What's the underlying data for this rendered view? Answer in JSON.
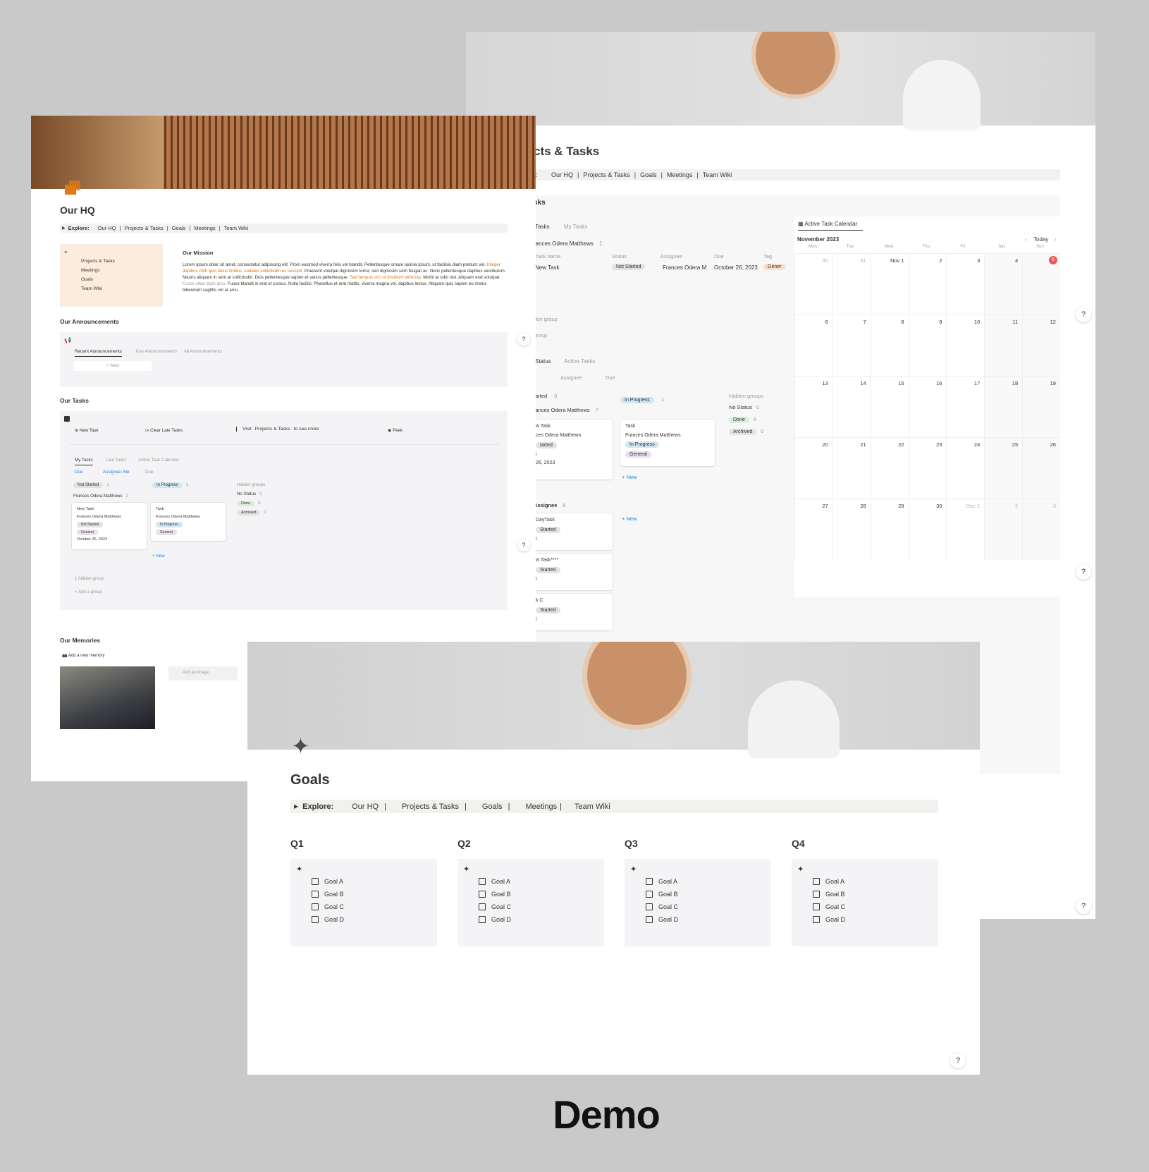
{
  "caption": "Demo",
  "colors": {
    "accent": "#e27a14",
    "background": "#c9c9c9",
    "today": "#eb5757"
  },
  "nav": {
    "explore": "Explore:",
    "items": [
      "Our HQ",
      "Projects & Tasks",
      "Goals",
      "Meetings",
      "Team Wiki"
    ],
    "sep": "|"
  },
  "hq": {
    "title": "Our HQ",
    "side_items": [
      "Projects & Tasks",
      "Meetings",
      "Goals",
      "Team Wiki"
    ],
    "mission_title": "Our Mission",
    "mission_text_1": "Lorem ipsum dolor sit amet, consectetur adipiscing elit. Proin euismod viverra felis vel blandit. Pellentesque ornare lacinia ipsum, ut facilisis diam pretium vel.",
    "mission_highlight_1": "Integer dapibus nibh quis lacus finibus, sodales sollicitudin ex suscipit.",
    "mission_text_2": "Praesent volutpat dignissim tortor, sed dignissim sem feugiat ac. Nunc pellentesque dapibus vestibulum. Mauris aliquam in sem at sollicitudin. Duis pellentesque sapien et varius pellentesque.",
    "mission_highlight_2": "Sed tempus orci ut tincidunt vehicula.",
    "mission_text_3": "Morbi at odio nisl. Aliquam erat volutpat.",
    "mission_muted": "Fusce vitae diam arcu.",
    "mission_text_4": "Fusce blandit in erat et cursus. Nulla facilisi. Phasellus et erat mattis, viverra magna vel, dapibus lectus. Aliquam quis sapien eu metus bibendum sagittis vel at arcu.",
    "announcements_title": "Our Announcements",
    "ann_tabs": [
      "Recent Announcements",
      "Key Announcements",
      "All Announcements"
    ],
    "ann_new": "+ New",
    "tasks_title": "Our Tasks",
    "btn_new_task": "New Task",
    "btn_clear": "Clear Late Tasks",
    "visit_pre": "Visit",
    "visit_link": "Projects & Tasks",
    "visit_post": "to see more",
    "btn_peek": "Peek",
    "task_tabs": [
      "My Tasks",
      "Late Tasks",
      "Active Task Calendar"
    ],
    "filters": [
      "Due",
      "Assignee: Me",
      "Due"
    ],
    "col_not_started": "Not Started",
    "col_not_started_count": "1",
    "col_in_progress": "In Progress",
    "col_in_progress_count": "1",
    "group_name": "Frances Odera Matthews",
    "group_count": "2",
    "hidden_groups": "Hidden groups",
    "hidden_list": [
      {
        "label": "No Status",
        "count": "0"
      },
      {
        "label": "Done",
        "count": "5"
      },
      {
        "label": "Archived",
        "count": "0"
      }
    ],
    "card1": {
      "title": "New Task",
      "assignee": "Frances Odera Matthews",
      "status": "Not Started",
      "tag": "General",
      "date": "October 26, 2023"
    },
    "card2": {
      "title": "Task",
      "assignee": "Frances Odera Matthews",
      "status": "In Progress",
      "tag": "General"
    },
    "new": "+ New",
    "hidden_group": "1 hidden group",
    "add_group": "+ Add a group",
    "memories_title": "Our Memories",
    "add_memory": "Add a new memory",
    "add_image": "Add an image"
  },
  "pt": {
    "title": "cts & Tasks",
    "explore_frag": ":",
    "section": "sks",
    "tabs": [
      "Tasks",
      "My Tasks"
    ],
    "group_name": "rances Odera Matthews",
    "group_count": "1",
    "cols": [
      "Task name",
      "Status",
      "Assignee",
      "Due",
      "Tag"
    ],
    "row": {
      "name": "New Task",
      "status": "Not Started",
      "assignee": "Frances Odera M",
      "due": "October 26, 2023",
      "tag": "Gener"
    },
    "hidden_group": "den group",
    "add_group": "group",
    "board_tabs": [
      "Status",
      "Active Tasks"
    ],
    "board_filters": [
      "Assignee",
      "Due"
    ],
    "b_col1": "tarted",
    "b_col1_count": "0",
    "b_col2": "In Progress",
    "b_col2_count": "1",
    "b_group": "rances Odera Matthews",
    "b_group_count": "7",
    "b_card1": {
      "title": "w Task",
      "assignee": "ces Odera Matthews",
      "status": "tarted",
      "x": "i",
      "date": "26, 2023"
    },
    "b_card2": {
      "title": "Task",
      "assignee": "Frances Odera Matthews",
      "status": "In Progress",
      "tag": "General"
    },
    "b_new": "+ New",
    "hidden_groups": "Hidden groups",
    "hidden_list": [
      {
        "label": "No Status",
        "count": "0"
      },
      {
        "label": "Done",
        "count": "8"
      },
      {
        "label": "Archived",
        "count": "0"
      }
    ],
    "assignee_group": "Assignee",
    "assignee_count": "6",
    "a_cards": [
      {
        "title": "DayTask",
        "status": "Started",
        "x": "i"
      },
      {
        "title": "w Task****",
        "status": "Started",
        "x": "i"
      },
      {
        "title": "k C",
        "status": "Started",
        "x": "i"
      }
    ],
    "a_new": "+ New",
    "calendar": {
      "tab": "Active Task Calendar",
      "month": "November 2023",
      "today": "Today",
      "weekdays": [
        "Mon",
        "Tue",
        "Wed",
        "Thu",
        "Fri",
        "Sat",
        "Sun"
      ],
      "weeks": [
        [
          "30",
          "31",
          "Nov 1",
          "2",
          "3",
          "4",
          "5"
        ],
        [
          "6",
          "7",
          "8",
          "9",
          "10",
          "11",
          "12"
        ],
        [
          "13",
          "14",
          "15",
          "16",
          "17",
          "18",
          "19"
        ],
        [
          "20",
          "21",
          "22",
          "23",
          "24",
          "25",
          "26"
        ],
        [
          "27",
          "28",
          "29",
          "30",
          "Dec 1",
          "2",
          "3"
        ]
      ]
    }
  },
  "goals": {
    "title": "Goals",
    "quarters": [
      {
        "label": "Q1",
        "items": [
          "Goal A",
          "Goal B",
          "Goal C",
          "Goal D"
        ]
      },
      {
        "label": "Q2",
        "items": [
          "Goal A",
          "Goal B",
          "Goal C",
          "Goal D"
        ]
      },
      {
        "label": "Q3",
        "items": [
          "Goal A",
          "Goal B",
          "Goal C",
          "Goal D"
        ]
      },
      {
        "label": "Q4",
        "items": [
          "Goal A",
          "Goal B",
          "Goal C",
          "Goal D"
        ]
      }
    ]
  },
  "help": "?"
}
